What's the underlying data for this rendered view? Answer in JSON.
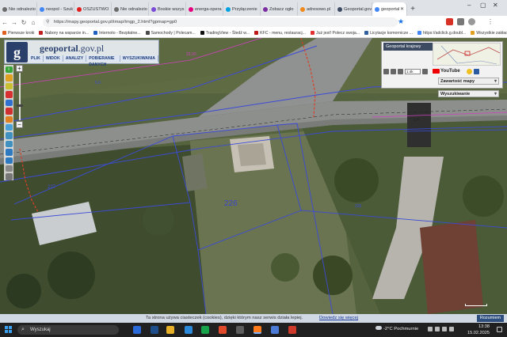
{
  "browser": {
    "tabs": [
      {
        "label": "Nie odnalezio",
        "color": "#6c6c6c"
      },
      {
        "label": "neopol - Szuk",
        "color": "#4285f4"
      },
      {
        "label": "OSZUSTWO",
        "color": "#e02020"
      },
      {
        "label": "Nie odnalezio",
        "color": "#6c6c6c"
      },
      {
        "label": "Boskie wszys",
        "color": "#7b4bd6"
      },
      {
        "label": "energa-opera",
        "color": "#e5007d"
      },
      {
        "label": "Przyłączenie",
        "color": "#00a3e0"
      },
      {
        "label": "Zobacz ogło",
        "color": "#7a2ea0"
      },
      {
        "label": "adresowo.pl",
        "color": "#f08a1c"
      },
      {
        "label": "Geoportal.gov",
        "color": "#3c4a62"
      },
      {
        "label": "geoportal",
        "color": "#4285f4",
        "active": true
      }
    ],
    "new_tab": "+",
    "url": "https://mapy.geoportal.gov.pl/imap/Imgp_2.html?gpmap=gp0",
    "url_domain": "geoportal",
    "window_controls": [
      "–",
      "▢",
      "✕"
    ],
    "bookmarks": [
      {
        "label": "Pierwsze kroki",
        "color": "#e06020"
      },
      {
        "label": "Nabory na wsparcie in...",
        "color": "#c02020"
      },
      {
        "label": "Internoto - Bezpłatne...",
        "color": "#2060c0"
      },
      {
        "label": "Samochody | Polecam...",
        "color": "#4a4a4a"
      },
      {
        "label": "TradingView - Śledź w...",
        "color": "#111111"
      },
      {
        "label": "KFC - menu, restauracj...",
        "color": "#c01818"
      },
      {
        "label": "Już jest! Polecz swoja...",
        "color": "#e03030"
      },
      {
        "label": "Licytacje komornicze ...",
        "color": "#3060a0"
      },
      {
        "label": "https://adclick.g.doubl...",
        "color": "#4285f4"
      },
      {
        "label": "Wszystkie zakładki",
        "color": "#e0a020"
      }
    ]
  },
  "geoportal": {
    "logo_letter": "g",
    "site_name_prefix": "geoportal",
    "site_name_suffix": ".gov.pl",
    "menu": [
      "PLIK",
      "WIDOK",
      "ANALIZY",
      "POBIERANIE DANYCH",
      "WYSZUKIWANIA"
    ],
    "zoom_in": "+",
    "zoom_out": "−",
    "overview_title": "Geoportal krajowy",
    "scale_value": "1:4k",
    "youtube_label": "YouTube",
    "panel_tools": "Zawartość mapy",
    "panel_search": "Wyszukiwanie",
    "parcel_number": "226",
    "map_labels": {
      "plot_a": "227",
      "plot_b": "225",
      "road_num": "1/4",
      "dist_a": "23,20",
      "dist_b": "5,0"
    }
  },
  "cookie_banner": {
    "text": "Ta strona używa ciasteczek (cookies), dzięki którym nasz serwis działa lepiej.",
    "link": "Dowiedz się więcej",
    "button": "Rozumiem"
  },
  "taskbar": {
    "search_placeholder": "Wyszukaj",
    "weather": "-2°C  Pochmurnie",
    "time": "13:38",
    "date": "15.02.2025"
  }
}
